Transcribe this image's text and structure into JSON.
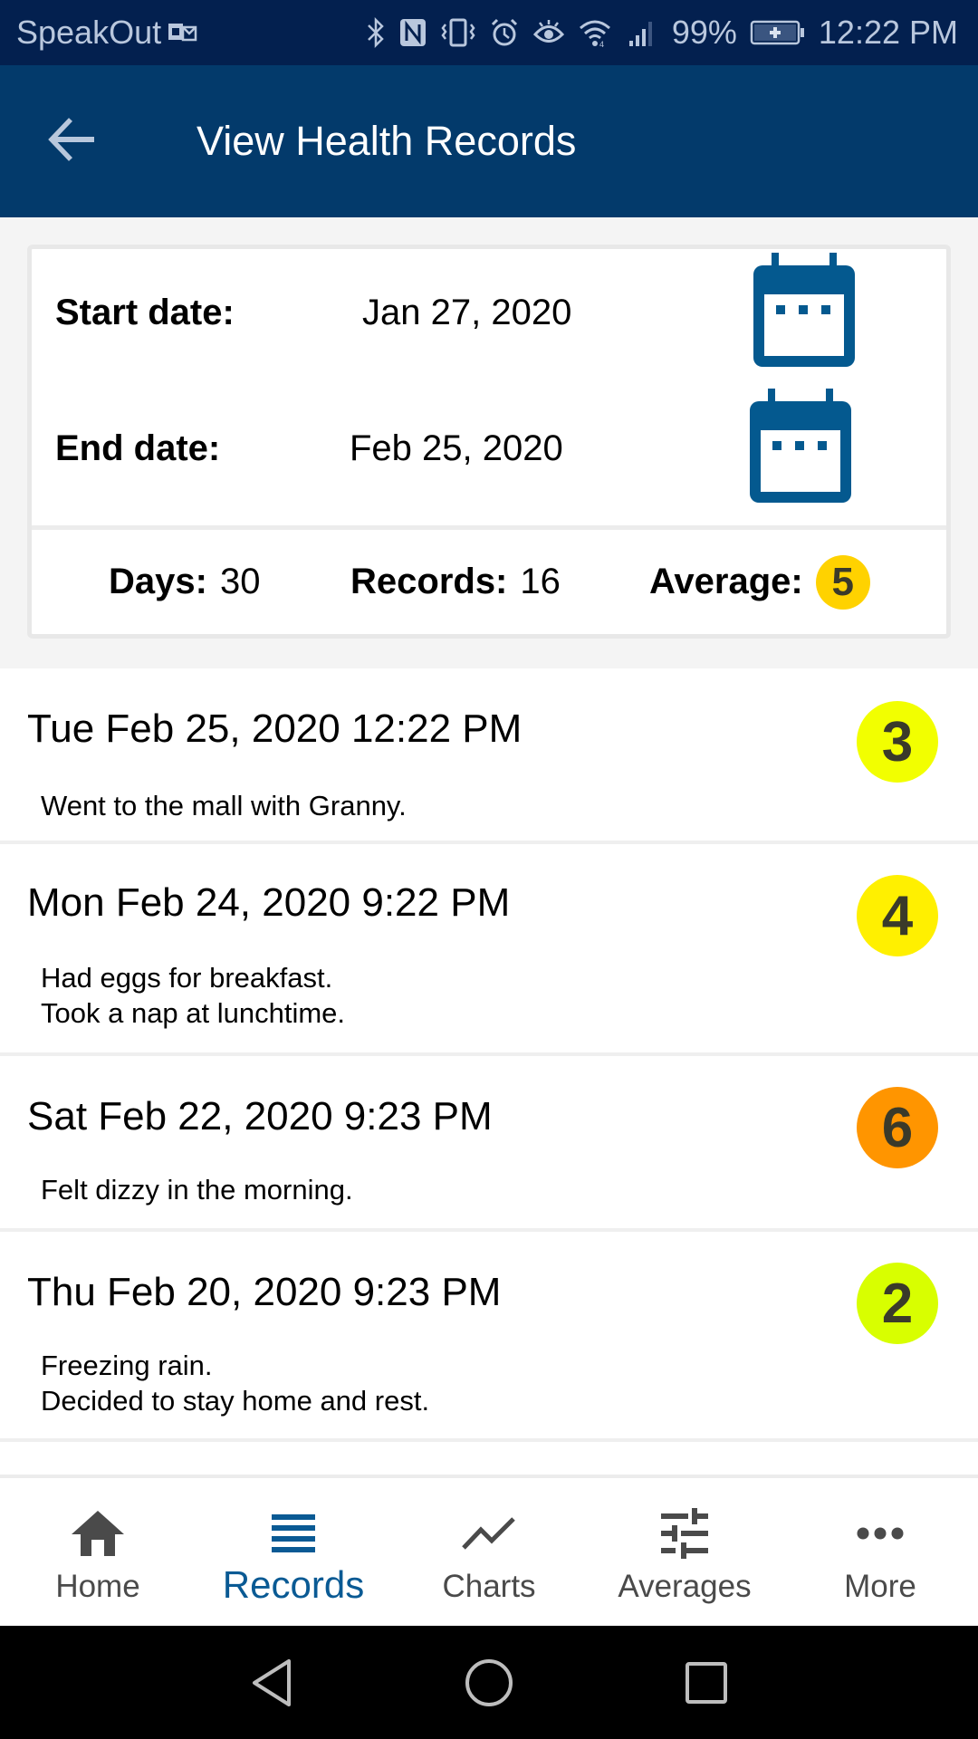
{
  "status_bar": {
    "app_name": "SpeakOut",
    "battery": "99%",
    "time": "12:22 PM",
    "icons": [
      "outlook-icon",
      "bluetooth-icon",
      "nfc-icon",
      "vibrate-icon",
      "alarm-icon",
      "eye-comfort-icon",
      "wifi-icon",
      "signal-icon",
      "battery-charging-icon"
    ]
  },
  "app_bar": {
    "title": "View Health Records",
    "back_icon": "arrow-left-icon"
  },
  "filter_card": {
    "start_label": "Start date:",
    "start_value": "Jan 27, 2020",
    "end_label": "End date:",
    "end_value": "Feb 25, 2020",
    "calendar_icon": "calendar-icon",
    "days_label": "Days:",
    "days_value": "30",
    "records_label": "Records:",
    "records_value": "16",
    "average_label": "Average:",
    "average_value": "5",
    "average_color": "#ffd200"
  },
  "records": [
    {
      "datetime": "Tue Feb 25, 2020 12:22 PM",
      "note": "Went to the mall with Granny.",
      "score": "3",
      "color": "#f2ff00"
    },
    {
      "datetime": "Mon Feb 24, 2020 9:22 PM",
      "note": "Had eggs for breakfast.\nTook a nap at lunchtime.",
      "score": "4",
      "color": "#fff000"
    },
    {
      "datetime": "Sat Feb 22, 2020 9:23 PM",
      "note": "Felt dizzy in the morning.",
      "score": "6",
      "color": "#ff9500"
    },
    {
      "datetime": "Thu Feb 20, 2020 9:23 PM",
      "note": "Freezing rain.\nDecided to stay home and rest.",
      "score": "2",
      "color": "#d8ff00"
    }
  ],
  "bottom_nav": {
    "items": [
      {
        "label": "Home",
        "icon": "home-icon",
        "active": false
      },
      {
        "label": "Records",
        "icon": "list-icon",
        "active": true
      },
      {
        "label": "Charts",
        "icon": "line-chart-icon",
        "active": false
      },
      {
        "label": "Averages",
        "icon": "sliders-icon",
        "active": false
      },
      {
        "label": "More",
        "icon": "more-horizontal-icon",
        "active": false
      }
    ],
    "active_color": "#0a5a94"
  },
  "system_nav": {
    "buttons": [
      "back",
      "home",
      "recents"
    ]
  },
  "colors": {
    "status_bar": "#03204f",
    "app_bar": "#033a6b",
    "accent": "#0a5a94"
  }
}
